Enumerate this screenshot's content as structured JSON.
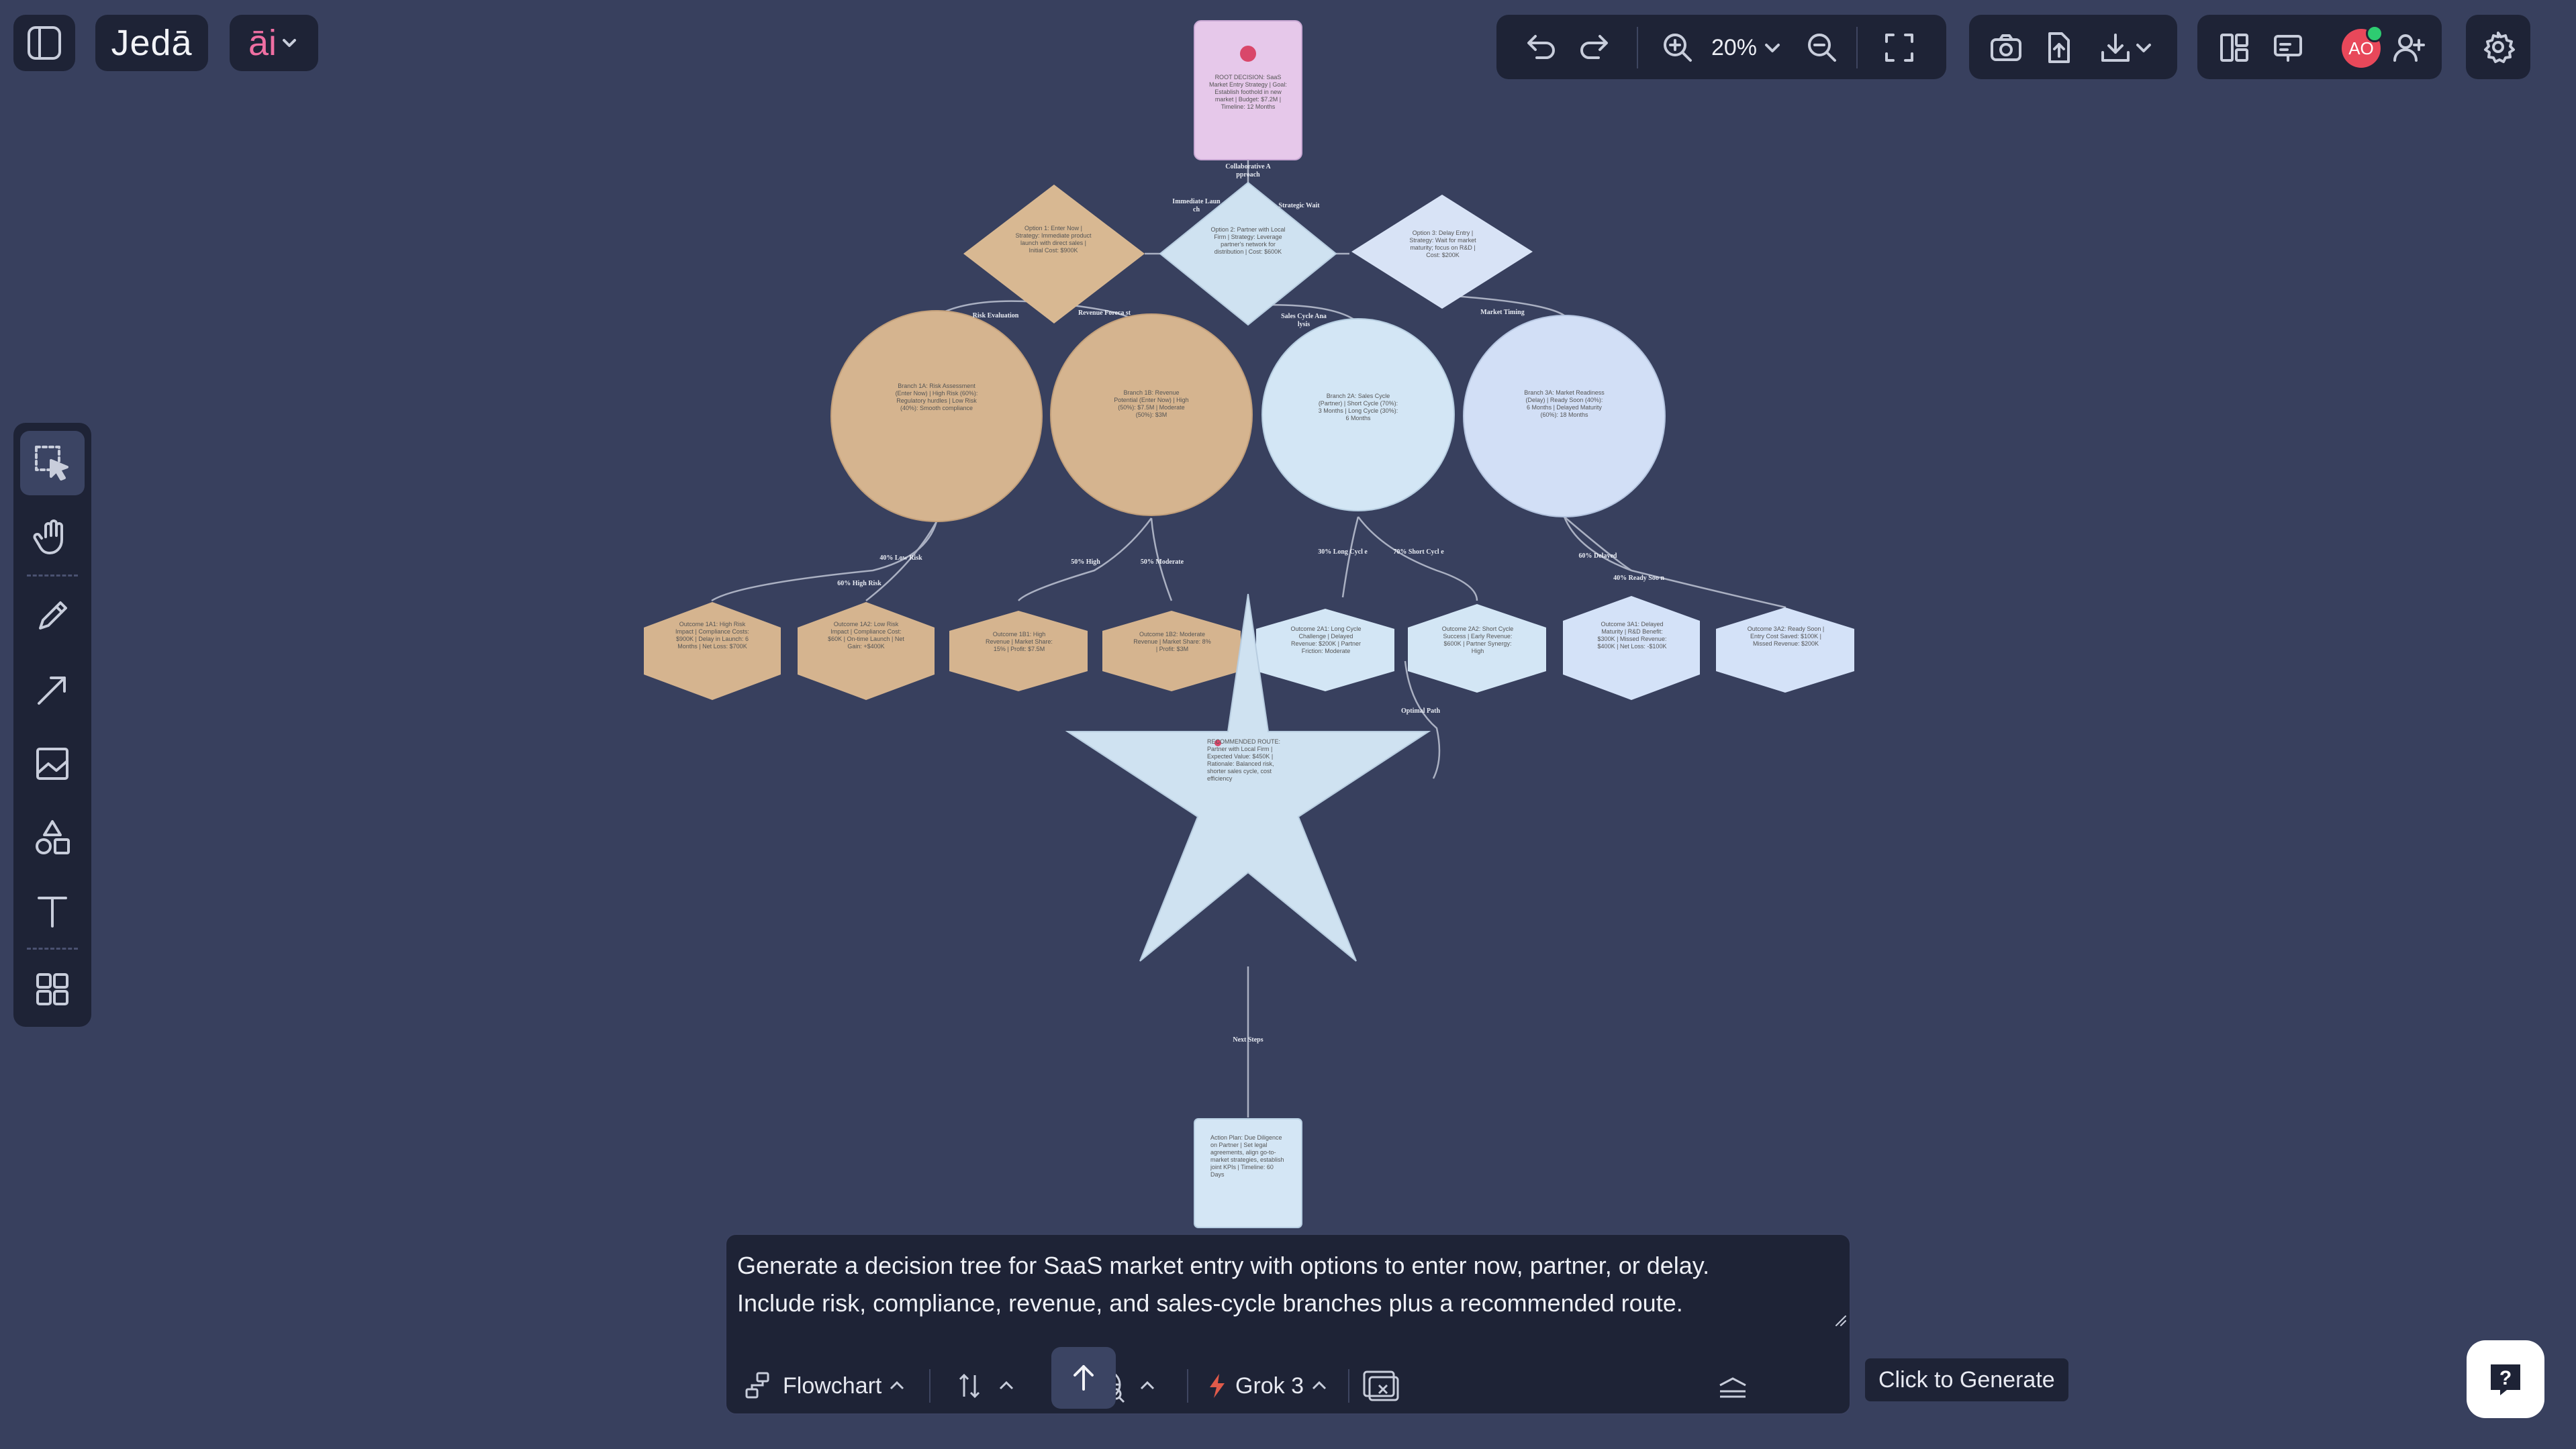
{
  "app": {
    "brand": "Jedā",
    "ai_label": "āi"
  },
  "toolbar": {
    "zoom": "20%"
  },
  "user": {
    "initials": "AO",
    "avatar_color": "#e8485a",
    "status_color": "#2ecc71"
  },
  "prompt": {
    "text_line1": "Generate a decision tree for SaaS market entry with options to enter now, partner, or delay.",
    "text_line2": "Include risk, compliance, revenue, and sales-cycle branches plus a recommended route.",
    "diagram_type": "Flowchart",
    "model": "Grok 3",
    "generate_tooltip": "Click to Generate"
  },
  "diagram": {
    "nodes": {
      "root": "ROOT DECISION: SaaS Market Entry Strategy | Goal: Establish foothold in new market | Budget: $7.2M | Timeline: 12 Months",
      "opt1": "Option 1: Enter Now | Strategy: Immediate product launch with direct sales | Initial Cost: $900K",
      "opt2": "Option 2: Partner with Local Firm | Strategy: Leverage partner's network for distribution | Cost: $600K",
      "opt3": "Option 3: Delay Entry | Strategy: Wait for market maturity; focus on R&D | Cost: $200K",
      "b1a": "Branch 1A: Risk Assessment (Enter Now) | High Risk (60%): Regulatory hurdles | Low Risk (40%): Smooth compliance",
      "b1b": "Branch 1B: Revenue Potential (Enter Now) | High (50%): $7.5M | Moderate (50%): $3M",
      "b2a": "Branch 2A: Sales Cycle (Partner) | Short Cycle (70%): 3 Months | Long Cycle (30%): 6 Months",
      "b3a": "Branch 3A: Market Readiness (Delay) | Ready Soon (40%): 6 Months | Delayed Maturity (60%): 18 Months",
      "o1": "Outcome 1A1: High Risk Impact | Compliance Costs: $900K | Delay in Launch: 6 Months | Net Loss: $700K",
      "o2": "Outcome 1A2: Low Risk Impact | Compliance Cost: $60K | On-time Launch | Net Gain: +$400K",
      "o3": "Outcome 1B1: High Revenue | Market Share: 15% | Profit: $7.5M",
      "o4": "Outcome 1B2: Moderate Revenue | Market Share: 8% | Profit: $3M",
      "o5": "Outcome 2A1: Long Cycle Challenge | Delayed Revenue: $200K | Partner Friction: Moderate",
      "o6": "Outcome 2A2: Short Cycle Success | Early Revenue: $600K | Partner Synergy: High",
      "o7": "Outcome 3A1: Delayed Maturity | R&D Benefit: $300K | Missed Revenue: $400K | Net Loss: -$100K",
      "o8": "Outcome 3A2: Ready Soon | Entry Cost Saved: $100K | Missed Revenue: $200K",
      "star": "RECOMMENDED ROUTE: Partner with Local Firm | Expected Value: $450K | Rationale: Balanced risk, shorter sales cycle, cost efficiency",
      "next": "Action Plan: Due Diligence on Partner | Set legal agreements, align go-to-market strategies, establish joint KPIs | Timeline: 60 Days"
    },
    "edge_labels": {
      "collab": "Collaborative A pproach",
      "imm": "Immediate Laun ch",
      "strat": "Strategic Wait",
      "risk": "Risk Evaluation",
      "rev": "Revenue Foreca st",
      "sales": "Sales Cycle Ana lysis",
      "mkt": "Market Timing",
      "low": "40% Low Risk",
      "high60": "60% High Risk",
      "high50": "50% High",
      "mod50": "50% Moderate",
      "long": "30% Long Cycl e",
      "short": "70% Short Cycl e",
      "delayed": "60% Delayed",
      "ready": "40% Ready Soo n",
      "optimal": "Optimal Path",
      "next": "Next Steps"
    }
  }
}
